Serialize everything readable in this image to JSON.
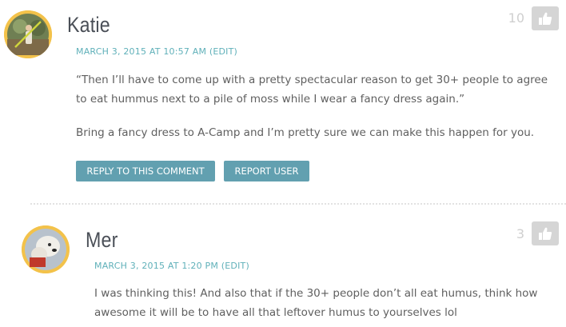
{
  "comments": [
    {
      "author": "Katie",
      "date": "MARCH 3, 2015 AT 10:57 AM",
      "edit_label": "(EDIT)",
      "paragraphs": [
        "“Then I’ll have to come up with a pretty spectacular reason to get 30+ people to agree to eat hummus next to a pile of moss while I wear a fancy dress again.”",
        "Bring a fancy dress to A-Camp and I’m pretty sure we can make this happen for you."
      ],
      "reply_label": "REPLY TO THIS COMMENT",
      "report_label": "REPORT USER",
      "likes": "10",
      "like_icon": "thumbs-up-icon"
    },
    {
      "author": "Mer",
      "date": "MARCH 3, 2015 AT 1:20 PM",
      "edit_label": "(EDIT)",
      "paragraphs": [
        "I was thinking this! And also that if the 30+ people don’t all eat humus, think how awesome it will be to have all that leftover humus to yourselves lol"
      ],
      "likes": "3",
      "like_icon": "thumbs-up-icon"
    }
  ],
  "colors": {
    "accent": "#5fb0b9",
    "button": "#62a0b0",
    "avatar_ring": "#f3c24a",
    "like_button": "#d5d5d5"
  }
}
